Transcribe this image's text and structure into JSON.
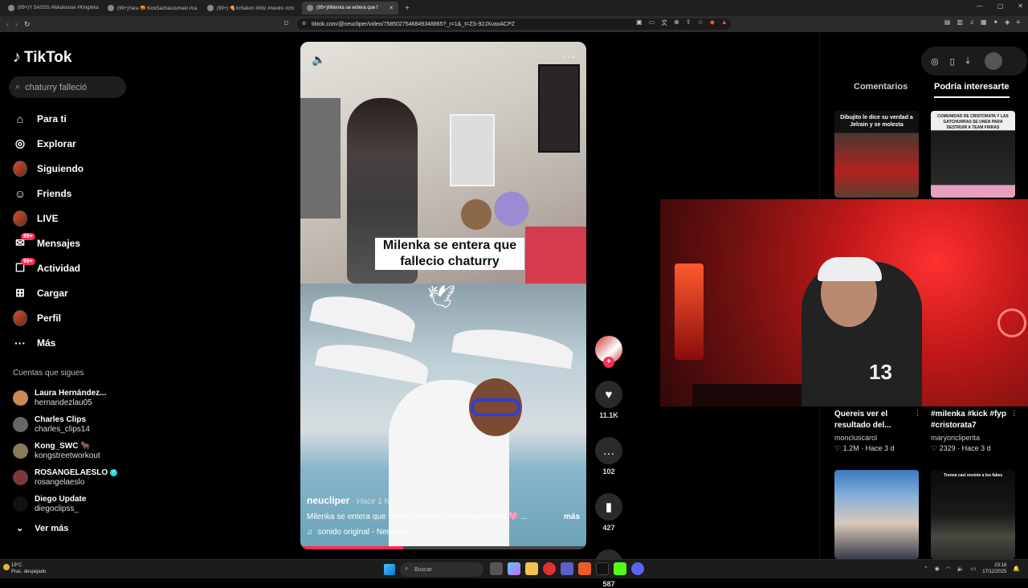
{
  "browser": {
    "tabs": [
      {
        "label": "(99+)Y SASSS #fekahouse #Kingteka"
      },
      {
        "label": "(99+)Yara 🤬 KickSachauzumaki #ca"
      },
      {
        "label": "(99+) 🍕#chaturri #fritz #neutro #chi"
      },
      {
        "label": "(99+)Milenka se entera que f",
        "active": true
      }
    ],
    "new_tab": "+",
    "url": "tiktok.com/@neucliper/video/7585027546849348865?_r=1&_t=ZS-92JXvaxACPZ"
  },
  "sidebar": {
    "logo": "TikTok",
    "search_value": "chaturry falleció",
    "nav": [
      {
        "label": "Para ti",
        "icon": "home-icon",
        "glyph": "⌂"
      },
      {
        "label": "Explorar",
        "icon": "compass-icon",
        "glyph": "◎"
      },
      {
        "label": "Siguiendo",
        "icon": "following-avatar-icon",
        "glyph": ""
      },
      {
        "label": "Friends",
        "icon": "friends-icon",
        "glyph": "☺"
      },
      {
        "label": "LIVE",
        "icon": "live-avatar-icon",
        "glyph": ""
      },
      {
        "label": "Mensajes",
        "icon": "messages-icon",
        "glyph": "✉",
        "badge": "99+"
      },
      {
        "label": "Actividad",
        "icon": "activity-icon",
        "glyph": "☐",
        "badge": "99+"
      },
      {
        "label": "Cargar",
        "icon": "upload-icon",
        "glyph": "⊞"
      },
      {
        "label": "Perfil",
        "icon": "profile-avatar-icon",
        "glyph": ""
      },
      {
        "label": "Más",
        "icon": "more-icon",
        "glyph": "···"
      }
    ],
    "following_title": "Cuentas que sigues",
    "following": [
      {
        "name": "Laura Hernández...",
        "handle": "hernandezlau05",
        "color": "#c98a5a"
      },
      {
        "name": "Charles Clips",
        "handle": "charles_clips14",
        "color": "#666666"
      },
      {
        "name": "Kong_SWC 🐂",
        "handle": "kongstreetworkout",
        "color": "#8a7a5a"
      },
      {
        "name": "ROSANGELAESLO",
        "handle": "rosangelaeslo",
        "color": "#7a3a3a",
        "verified": true
      },
      {
        "name": "Diego Update",
        "handle": "diegoclipss_",
        "color": "#111111"
      }
    ],
    "ver_mas": "Ver más"
  },
  "video": {
    "caption_overlay": "Milenka se entera que fallecio chaturry",
    "author": "neucliper",
    "time": " · Hace 1 h",
    "description": "Milenka se entera que fallecio chaturry #milenkanolasco 🩷 ...",
    "more": "más",
    "sound": "sonido original - Neuclips",
    "progress_fraction": 0.36
  },
  "actions": {
    "likes": "11.1K",
    "comments": "102",
    "saves": "427",
    "shares": "587"
  },
  "right_panel": {
    "tab_comments": "Comentarios",
    "tab_interest": "Podría interesarte",
    "thumb1_text": "Dibujito le dice su verdad a Jelrain y se molesta",
    "thumb2_text": "COMUNIDAD DE CRISTORATA Y LAS GATCHURRAS SE UNEN PARA DESTRUIR A TEAM FIRRAS",
    "thumb4_text": "Tronna casi enviste a los fakes",
    "cards": [
      {
        "title": "Quereis ver el resultado del...",
        "user": "moncluscarol",
        "likes": "1.2M",
        "time": "Hace 3 d"
      },
      {
        "title": "#milenka #kick #fyp #cristorata7",
        "user": "maryoricliperita",
        "likes": "2329",
        "time": "Hace 3 d"
      }
    ]
  },
  "stream": {
    "jersey_number": "13"
  },
  "taskbar": {
    "temp": "19°C",
    "weather": "Prac. despejado",
    "search_placeholder": "Buscar",
    "time": "23:18",
    "date": "17/12/2025"
  }
}
